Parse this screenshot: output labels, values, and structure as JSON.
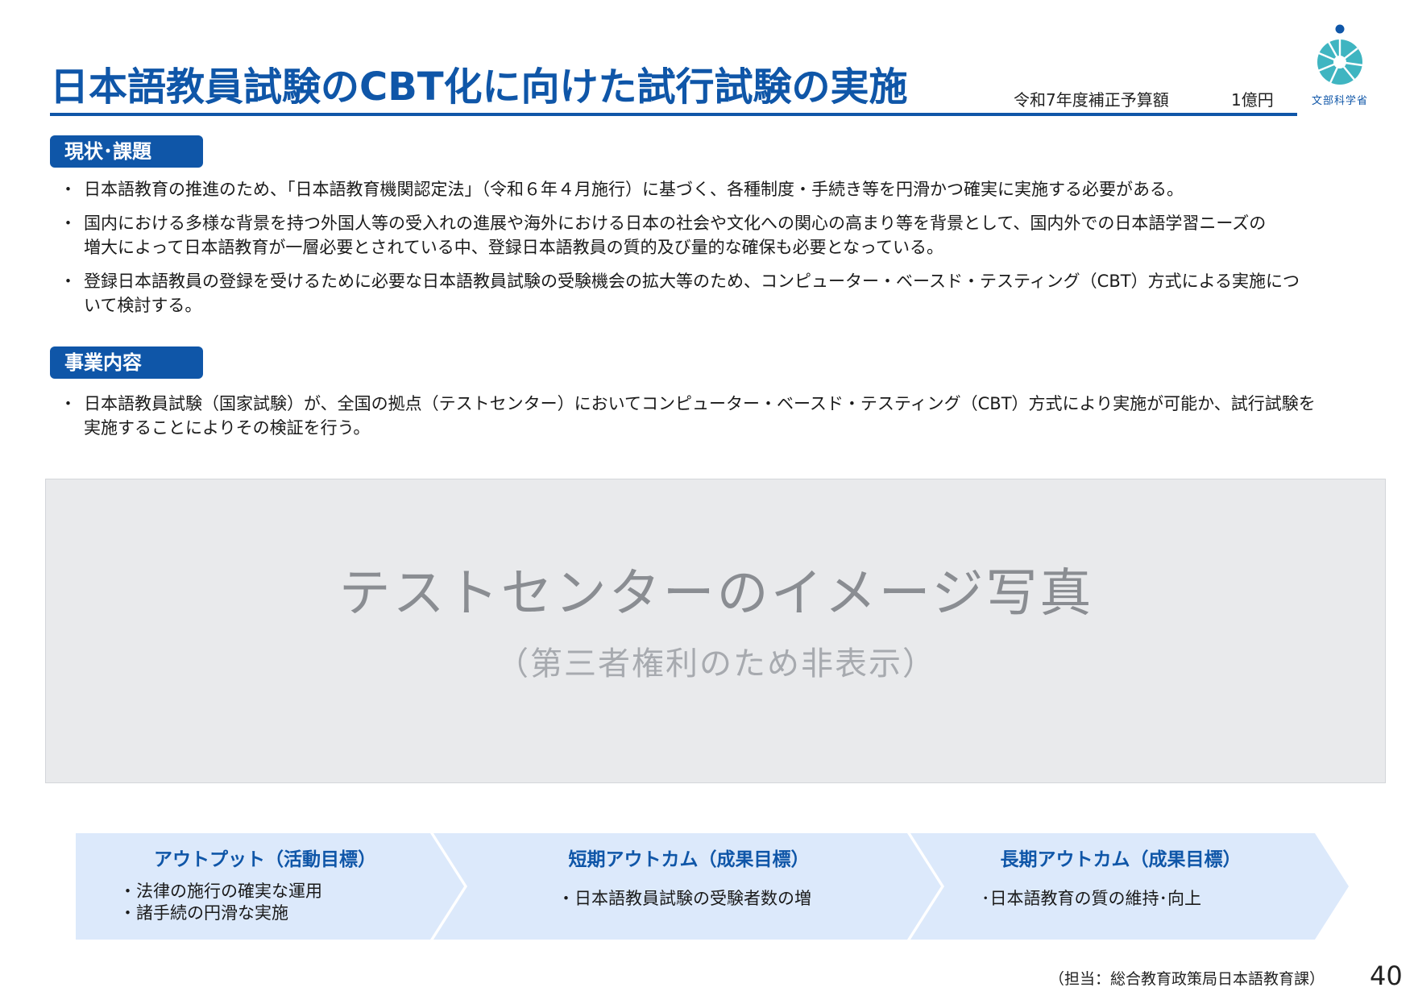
{
  "header": {
    "title": "日本語教員試験のCBT化に向けた試行試験の実施",
    "budget_label": "令和7年度補正予算額",
    "budget_amount": "1億円",
    "logo_text": "文部科学省",
    "accent_color": "#0f56a8"
  },
  "status_section": {
    "label": "現状･課題",
    "bullets": [
      {
        "marker": "・",
        "lines": [
          "日本語教育の推進のため、「日本語教育機関認定法」（令和６年４月施行）に基づく、各種制度・手続き等を円滑かつ確実に実施する必要がある。"
        ]
      },
      {
        "marker": "・",
        "lines": [
          "国内における多様な背景を持つ外国人等の受入れの進展や海外における日本の社会や文化への関心の高まり等を背景として、国内外での日本語学習ニーズの",
          "増大によって日本語教育が一層必要とされている中、登録日本語教員の質的及び量的な確保も必要となっている。"
        ]
      },
      {
        "marker": "・",
        "lines": [
          "登録日本語教員の登録を受けるために必要な日本語教員試験の受験機会の拡大等のため、コンピューター・ベースド・テスティング（CBT）方式による実施につ",
          "いて検討する。"
        ]
      }
    ]
  },
  "business_section": {
    "label": "事業内容",
    "bullets": [
      {
        "marker": "・",
        "lines": [
          "日本語教員試験（国家試験）が、全国の拠点（テストセンター）においてコンピューター・ベースド・テスティング（CBT）方式により実施が可能か、試行試験を",
          "実施することによりその検証を行う。"
        ]
      }
    ]
  },
  "image_placeholder": {
    "main_text": "テストセンターのイメージ写真",
    "sub_text": "（第三者権利のため非表示）"
  },
  "outcomes": [
    {
      "title": "アウトプット（活動目標）",
      "items": [
        "・法律の施行の確実な運用",
        "・諸手続の円滑な実施"
      ]
    },
    {
      "title": "短期アウトカム（成果目標）",
      "items": [
        "・日本語教員試験の受験者数の増"
      ]
    },
    {
      "title": "長期アウトカム（成果目標）",
      "items": [
        "･日本語教育の質の維持･向上"
      ]
    }
  ],
  "footer": {
    "contact": "（担当：総合教育政策局日本語教育課）",
    "page_number": "40"
  }
}
